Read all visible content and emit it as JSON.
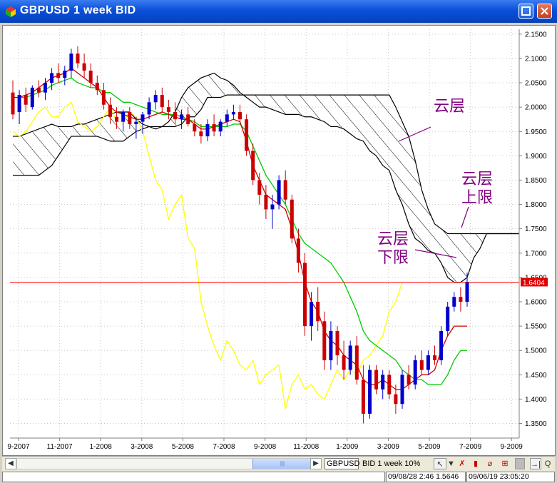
{
  "window": {
    "title": "GBPUSD 1 week BID"
  },
  "chart_data": {
    "type": "candlestick",
    "symbol": "GBPUSD",
    "interval": "1 week",
    "ylim": [
      1.32,
      2.16
    ],
    "y_ticks": [
      "2.1500",
      "2.1000",
      "2.0500",
      "2.0000",
      "1.9500",
      "1.9000",
      "1.8500",
      "1.8000",
      "1.7500",
      "1.7000",
      "1.6500",
      "1.6000",
      "1.5500",
      "1.5000",
      "1.4500",
      "1.4000",
      "1.3500"
    ],
    "x_ticks": [
      "9-2007",
      "11-2007",
      "1-2008",
      "3-2008",
      "5-2008",
      "7-2008",
      "9-2008",
      "11-2008",
      "1-2009",
      "3-2009",
      "5-2009",
      "7-2009",
      "9-2009"
    ],
    "current_price": 1.6404,
    "current_price_label": "1.6404",
    "annotations": [
      {
        "id": "cloud",
        "text": "云层"
      },
      {
        "id": "cloud-upper-1",
        "text": "云层"
      },
      {
        "id": "cloud-upper-2",
        "text": "上限"
      },
      {
        "id": "cloud-lower-1",
        "text": "云层"
      },
      {
        "id": "cloud-lower-2",
        "text": "下限"
      }
    ],
    "colors": {
      "up": "#0000cc",
      "down": "#cc0000",
      "tenkan": "#cc0000",
      "kijun": "#00cc00",
      "chikou": "#ffff00",
      "senkou": "#000000",
      "price_line": "#ff0000",
      "annotation": "#800080"
    },
    "candles": [
      {
        "o": 2.03,
        "h": 2.055,
        "l": 1.975,
        "c": 1.985
      },
      {
        "o": 1.99,
        "h": 2.035,
        "l": 1.965,
        "c": 2.025
      },
      {
        "o": 2.025,
        "h": 2.04,
        "l": 1.99,
        "c": 2.005
      },
      {
        "o": 2.0,
        "h": 2.045,
        "l": 1.995,
        "c": 2.04
      },
      {
        "o": 2.04,
        "h": 2.055,
        "l": 2.02,
        "c": 2.03
      },
      {
        "o": 2.03,
        "h": 2.06,
        "l": 2.015,
        "c": 2.05
      },
      {
        "o": 2.05,
        "h": 2.08,
        "l": 2.035,
        "c": 2.07
      },
      {
        "o": 2.07,
        "h": 2.09,
        "l": 2.05,
        "c": 2.06
      },
      {
        "o": 2.06,
        "h": 2.085,
        "l": 2.045,
        "c": 2.075
      },
      {
        "o": 2.075,
        "h": 2.12,
        "l": 2.06,
        "c": 2.11
      },
      {
        "o": 2.11,
        "h": 2.125,
        "l": 2.08,
        "c": 2.09
      },
      {
        "o": 2.09,
        "h": 2.11,
        "l": 2.06,
        "c": 2.075
      },
      {
        "o": 2.075,
        "h": 2.09,
        "l": 2.04,
        "c": 2.05
      },
      {
        "o": 2.05,
        "h": 2.065,
        "l": 2.025,
        "c": 2.035
      },
      {
        "o": 2.035,
        "h": 2.05,
        "l": 1.995,
        "c": 2.005
      },
      {
        "o": 2.005,
        "h": 2.02,
        "l": 1.965,
        "c": 1.98
      },
      {
        "o": 1.98,
        "h": 2.0,
        "l": 1.955,
        "c": 1.97
      },
      {
        "o": 1.97,
        "h": 1.995,
        "l": 1.95,
        "c": 1.99
      },
      {
        "o": 1.99,
        "h": 2.0,
        "l": 1.955,
        "c": 1.965
      },
      {
        "o": 1.965,
        "h": 1.98,
        "l": 1.935,
        "c": 1.97
      },
      {
        "o": 1.97,
        "h": 1.99,
        "l": 1.945,
        "c": 1.985
      },
      {
        "o": 1.985,
        "h": 2.02,
        "l": 1.975,
        "c": 2.01
      },
      {
        "o": 2.01,
        "h": 2.035,
        "l": 1.995,
        "c": 2.025
      },
      {
        "o": 2.025,
        "h": 2.04,
        "l": 1.99,
        "c": 2.0
      },
      {
        "o": 2.0,
        "h": 2.015,
        "l": 1.975,
        "c": 1.99
      },
      {
        "o": 1.99,
        "h": 2.01,
        "l": 1.965,
        "c": 1.975
      },
      {
        "o": 1.975,
        "h": 1.995,
        "l": 1.955,
        "c": 1.985
      },
      {
        "o": 1.985,
        "h": 2.0,
        "l": 1.96,
        "c": 1.965
      },
      {
        "o": 1.965,
        "h": 1.975,
        "l": 1.94,
        "c": 1.95
      },
      {
        "o": 1.95,
        "h": 1.965,
        "l": 1.925,
        "c": 1.94
      },
      {
        "o": 1.94,
        "h": 1.975,
        "l": 1.93,
        "c": 1.965
      },
      {
        "o": 1.965,
        "h": 1.985,
        "l": 1.94,
        "c": 1.95
      },
      {
        "o": 1.95,
        "h": 1.975,
        "l": 1.94,
        "c": 1.97
      },
      {
        "o": 1.97,
        "h": 1.995,
        "l": 1.96,
        "c": 1.985
      },
      {
        "o": 1.985,
        "h": 2.005,
        "l": 1.975,
        "c": 1.99
      },
      {
        "o": 1.99,
        "h": 2.005,
        "l": 1.965,
        "c": 1.975
      },
      {
        "o": 1.975,
        "h": 1.985,
        "l": 1.9,
        "c": 1.91
      },
      {
        "o": 1.91,
        "h": 1.925,
        "l": 1.84,
        "c": 1.85
      },
      {
        "o": 1.85,
        "h": 1.865,
        "l": 1.8,
        "c": 1.82
      },
      {
        "o": 1.82,
        "h": 1.84,
        "l": 1.77,
        "c": 1.79
      },
      {
        "o": 1.79,
        "h": 1.82,
        "l": 1.75,
        "c": 1.8
      },
      {
        "o": 1.8,
        "h": 1.86,
        "l": 1.79,
        "c": 1.85
      },
      {
        "o": 1.85,
        "h": 1.87,
        "l": 1.8,
        "c": 1.81
      },
      {
        "o": 1.81,
        "h": 1.82,
        "l": 1.72,
        "c": 1.73
      },
      {
        "o": 1.73,
        "h": 1.75,
        "l": 1.66,
        "c": 1.68
      },
      {
        "o": 1.68,
        "h": 1.7,
        "l": 1.53,
        "c": 1.55
      },
      {
        "o": 1.55,
        "h": 1.62,
        "l": 1.52,
        "c": 1.6
      },
      {
        "o": 1.6,
        "h": 1.63,
        "l": 1.54,
        "c": 1.56
      },
      {
        "o": 1.56,
        "h": 1.58,
        "l": 1.46,
        "c": 1.48
      },
      {
        "o": 1.48,
        "h": 1.56,
        "l": 1.46,
        "c": 1.54
      },
      {
        "o": 1.54,
        "h": 1.55,
        "l": 1.47,
        "c": 1.49
      },
      {
        "o": 1.49,
        "h": 1.52,
        "l": 1.44,
        "c": 1.46
      },
      {
        "o": 1.46,
        "h": 1.52,
        "l": 1.45,
        "c": 1.51
      },
      {
        "o": 1.51,
        "h": 1.53,
        "l": 1.43,
        "c": 1.44
      },
      {
        "o": 1.44,
        "h": 1.47,
        "l": 1.35,
        "c": 1.37
      },
      {
        "o": 1.37,
        "h": 1.47,
        "l": 1.36,
        "c": 1.46
      },
      {
        "o": 1.46,
        "h": 1.47,
        "l": 1.41,
        "c": 1.42
      },
      {
        "o": 1.42,
        "h": 1.46,
        "l": 1.4,
        "c": 1.45
      },
      {
        "o": 1.45,
        "h": 1.46,
        "l": 1.4,
        "c": 1.41
      },
      {
        "o": 1.41,
        "h": 1.43,
        "l": 1.37,
        "c": 1.39
      },
      {
        "o": 1.39,
        "h": 1.46,
        "l": 1.38,
        "c": 1.45
      },
      {
        "o": 1.45,
        "h": 1.47,
        "l": 1.42,
        "c": 1.43
      },
      {
        "o": 1.43,
        "h": 1.49,
        "l": 1.42,
        "c": 1.48
      },
      {
        "o": 1.48,
        "h": 1.5,
        "l": 1.45,
        "c": 1.46
      },
      {
        "o": 1.46,
        "h": 1.5,
        "l": 1.45,
        "c": 1.49
      },
      {
        "o": 1.49,
        "h": 1.51,
        "l": 1.47,
        "c": 1.48
      },
      {
        "o": 1.48,
        "h": 1.55,
        "l": 1.47,
        "c": 1.54
      },
      {
        "o": 1.54,
        "h": 1.6,
        "l": 1.53,
        "c": 1.59
      },
      {
        "o": 1.59,
        "h": 1.62,
        "l": 1.58,
        "c": 1.61
      },
      {
        "o": 1.61,
        "h": 1.63,
        "l": 1.58,
        "c": 1.6
      },
      {
        "o": 1.6,
        "h": 1.66,
        "l": 1.59,
        "c": 1.64
      }
    ],
    "tenkan": [
      2.02,
      2.02,
      2.025,
      2.03,
      2.04,
      2.05,
      2.06,
      2.065,
      2.07,
      2.08,
      2.07,
      2.06,
      2.05,
      2.04,
      2.02,
      2.0,
      1.99,
      1.985,
      1.98,
      1.975,
      1.975,
      1.98,
      1.985,
      1.99,
      1.985,
      1.98,
      1.975,
      1.975,
      1.965,
      1.955,
      1.955,
      1.96,
      1.965,
      1.97,
      1.975,
      1.97,
      1.93,
      1.88,
      1.85,
      1.82,
      1.81,
      1.8,
      1.79,
      1.75,
      1.7,
      1.64,
      1.6,
      1.58,
      1.54,
      1.52,
      1.51,
      1.49,
      1.48,
      1.47,
      1.44,
      1.43,
      1.43,
      1.44,
      1.43,
      1.42,
      1.42,
      1.43,
      1.44,
      1.45,
      1.45,
      1.46,
      1.5,
      1.53,
      1.55,
      1.55,
      1.55
    ],
    "kijun": [
      2.02,
      2.02,
      2.02,
      2.025,
      2.03,
      2.035,
      2.045,
      2.05,
      2.055,
      2.06,
      2.05,
      2.045,
      2.04,
      2.04,
      2.03,
      2.03,
      2.02,
      2.01,
      2.01,
      2.005,
      2.0,
      1.995,
      1.99,
      1.985,
      1.985,
      1.985,
      1.98,
      1.975,
      1.97,
      1.96,
      1.96,
      1.96,
      1.96,
      1.96,
      1.965,
      1.965,
      1.95,
      1.92,
      1.89,
      1.86,
      1.84,
      1.82,
      1.8,
      1.77,
      1.74,
      1.72,
      1.71,
      1.7,
      1.69,
      1.68,
      1.66,
      1.64,
      1.61,
      1.58,
      1.54,
      1.52,
      1.51,
      1.5,
      1.49,
      1.48,
      1.46,
      1.45,
      1.44,
      1.44,
      1.43,
      1.43,
      1.43,
      1.45,
      1.48,
      1.5,
      1.5
    ],
    "chikou": [
      1.95,
      1.94,
      1.95,
      1.97,
      1.99,
      2.0,
      1.98,
      1.98,
      2.0,
      2.01,
      1.97,
      1.96,
      1.95,
      1.96,
      1.98,
      2.0,
      1.97,
      1.97,
      1.99,
      1.98,
      1.95,
      1.9,
      1.85,
      1.83,
      1.77,
      1.8,
      1.82,
      1.73,
      1.71,
      1.6,
      1.55,
      1.51,
      1.48,
      1.52,
      1.5,
      1.47,
      1.46,
      1.48,
      1.43,
      1.45,
      1.46,
      1.47,
      1.38,
      1.43,
      1.45,
      1.42,
      1.43,
      1.41,
      1.4,
      1.43,
      1.46,
      1.44,
      1.46,
      1.45,
      1.48,
      1.49,
      1.51,
      1.53,
      1.58,
      1.6,
      1.64
    ],
    "senkou_a": [
      1.94,
      1.94,
      1.945,
      1.95,
      1.955,
      1.96,
      1.965,
      1.96,
      1.96,
      1.96,
      1.965,
      1.965,
      1.97,
      1.975,
      1.98,
      1.985,
      1.99,
      1.99,
      1.99,
      1.975,
      1.965,
      1.96,
      1.955,
      1.96,
      1.97,
      1.99,
      2.02,
      2.04,
      2.05,
      2.06,
      2.065,
      2.07,
      2.06,
      2.055,
      2.045,
      2.03,
      2.02,
      2.01,
      2.0,
      2.0,
      1.995,
      1.99,
      1.985,
      1.985,
      1.985,
      1.98,
      1.98,
      1.975,
      1.97,
      1.96,
      1.96,
      1.955,
      1.945,
      1.935,
      1.93,
      1.91,
      1.9,
      1.88,
      1.87,
      1.83,
      1.8,
      1.76,
      1.73,
      1.72,
      1.705,
      1.7,
      1.68,
      1.65,
      1.64,
      1.64,
      1.65,
      1.69,
      1.71,
      1.74,
      1.74,
      1.74,
      1.74,
      1.74,
      1.74
    ],
    "senkou_b": [
      1.86,
      1.86,
      1.86,
      1.86,
      1.86,
      1.87,
      1.88,
      1.9,
      1.92,
      1.94,
      1.94,
      1.94,
      1.94,
      1.94,
      1.935,
      1.93,
      1.93,
      1.93,
      1.94,
      1.95,
      1.955,
      1.96,
      1.96,
      1.96,
      1.96,
      1.96,
      1.965,
      1.98,
      1.98,
      1.995,
      2.02,
      2.02,
      2.02,
      2.025,
      2.025,
      2.025,
      2.025,
      2.025,
      2.025,
      2.025,
      2.025,
      2.025,
      2.025,
      2.025,
      2.025,
      2.025,
      2.025,
      2.025,
      2.025,
      2.025,
      2.025,
      2.025,
      2.025,
      2.025,
      2.025,
      2.025,
      2.025,
      2.025,
      2.025,
      2.0,
      1.97,
      1.94,
      1.89,
      1.83,
      1.79,
      1.76,
      1.75,
      1.74,
      1.74,
      1.74,
      1.74,
      1.74,
      1.74,
      1.74,
      1.74,
      1.74,
      1.74,
      1.74,
      1.74
    ]
  },
  "toolbar": {
    "symbol": "GBPUSD",
    "info": "BID  1 week  10%"
  },
  "status": {
    "cursor": "09/08/28 2:46  1.5646",
    "time": "09/06/19 23:05:20"
  }
}
